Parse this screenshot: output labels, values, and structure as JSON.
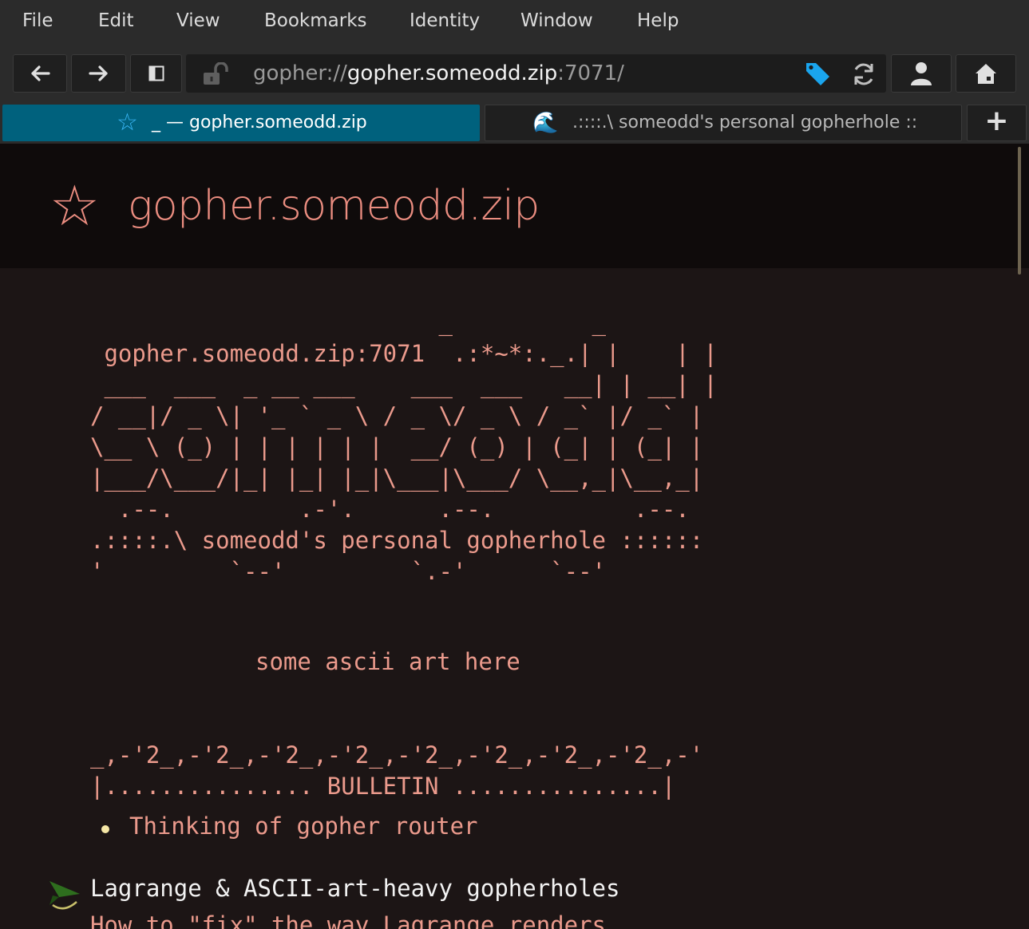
{
  "menubar": {
    "items": [
      "File",
      "Edit",
      "View",
      "Bookmarks",
      "Identity",
      "Window",
      "Help"
    ]
  },
  "toolbar": {
    "url_scheme": "gopher://",
    "url_host": "gopher.someodd.zip",
    "url_rest": ":7071/",
    "icons": [
      "back-arrow-icon",
      "forward-arrow-icon",
      "sidebar-toggle-icon",
      "unlocked-padlock-icon",
      "bookmark-tag-icon",
      "reload-icon",
      "identity-person-icon",
      "home-icon"
    ]
  },
  "tabs": [
    {
      "icon": "☆",
      "label": "_ — gopher.someodd.zip",
      "active": true
    },
    {
      "icon": "🌊",
      "label": ".::::.\\ someodd's personal gopherhole ::",
      "active": false
    }
  ],
  "new_tab_label": "+",
  "page": {
    "header_icon": "☆",
    "header_title": "gopher.someodd.zip",
    "banner_lines": [
      "                         _          _ ",
      " gopher.someodd.zip:7071  .:*~*:._.| |    | |",
      " ___  ___  _ __ ___    ___  ___   __| | __| |",
      "/ __|/ _ \\| '_ ` _ \\ / _ \\/ _ \\ / _` |/ _` |",
      "\\__ \\ (_) | | | | | |  __/ (_) | (_| | (_| |",
      "|___/\\___/|_| |_| |_|\\___|\\___/ \\__,_|\\__,_|",
      "  .--.         .-'.      .--.          .--.",
      ".::::.\\ someodd's personal gopherhole ::::::",
      "'         `--'         `.-'      `--'"
    ],
    "ascii_art_caption": "some ascii art here",
    "bulletin_lines": [
      "_,-'2_,-'2_,-'2_,-'2_,-'2_,-'2_,-'2_,-'2_,-'",
      "|............... BULLETIN ...............|"
    ],
    "bullet_item": "Thinking of gopher router",
    "link_title": "Lagrange & ASCII-art-heavy gopherholes",
    "link_subtitle": "How to \"fix\" the way Lagrange renders"
  },
  "colors": {
    "accent_tab": "#00617d",
    "page_text": "#eb9a8c",
    "page_bg": "#1c1515",
    "bullet": "#f5e7a6",
    "link_icon": "#2e6e1e"
  }
}
